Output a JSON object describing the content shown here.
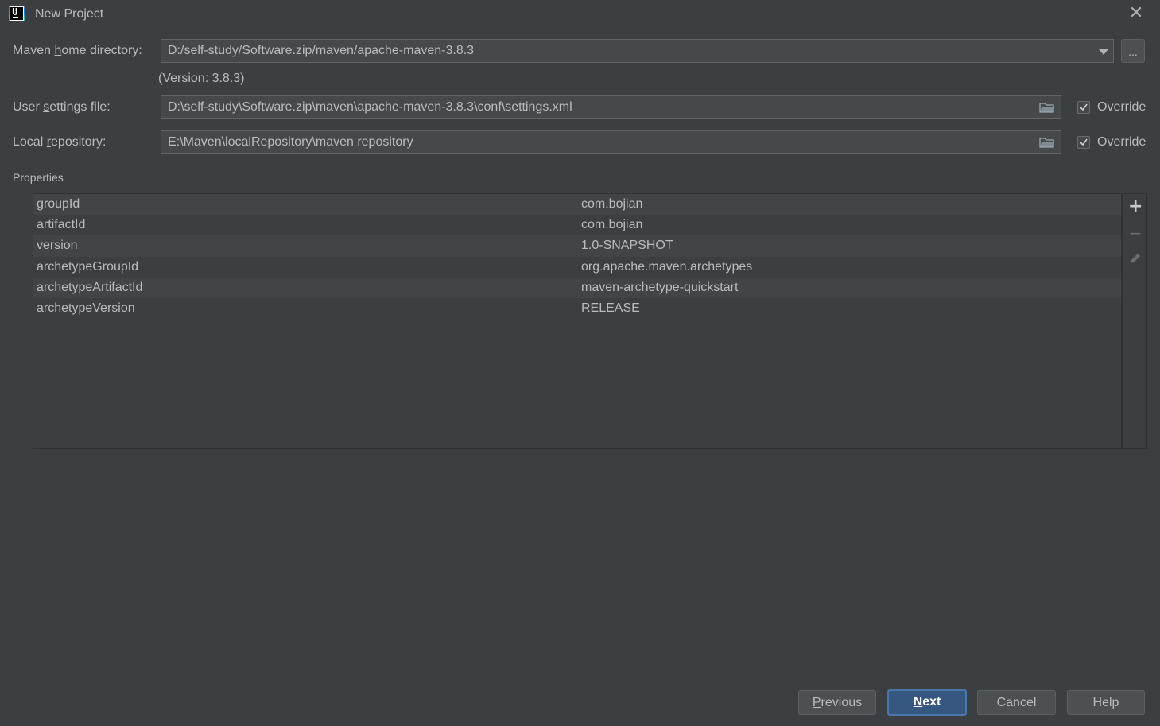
{
  "window": {
    "title": "New Project",
    "icon": "intellij-idea-icon",
    "close_icon": "close-icon"
  },
  "form": {
    "maven_home": {
      "label_pre": "Maven ",
      "label_mnemonic": "h",
      "label_post": "ome directory:",
      "value": "D:/self-study/Software.zip/maven/apache-maven-3.8.3",
      "browse_label": "...",
      "version_note": "(Version: 3.8.3)"
    },
    "user_settings": {
      "label_pre": "User ",
      "label_mnemonic": "s",
      "label_post": "ettings file:",
      "value": "D:\\self-study\\Software.zip\\maven\\apache-maven-3.8.3\\conf\\settings.xml",
      "override_label": "Override",
      "override_checked": true
    },
    "local_repository": {
      "label_pre": "Local ",
      "label_mnemonic": "r",
      "label_post": "epository:",
      "value": "E:\\Maven\\localRepository\\maven repository",
      "override_label": "Override",
      "override_checked": true
    }
  },
  "properties": {
    "title": "Properties",
    "rows": [
      {
        "key": "groupId",
        "value": "com.bojian"
      },
      {
        "key": "artifactId",
        "value": "com.bojian"
      },
      {
        "key": "version",
        "value": "1.0-SNAPSHOT"
      },
      {
        "key": "archetypeGroupId",
        "value": "org.apache.maven.archetypes"
      },
      {
        "key": "archetypeArtifactId",
        "value": "maven-archetype-quickstart"
      },
      {
        "key": "archetypeVersion",
        "value": "RELEASE"
      }
    ],
    "toolbar": {
      "add_icon": "plus-icon",
      "remove_icon": "minus-icon",
      "edit_icon": "pencil-icon"
    }
  },
  "footer": {
    "previous": {
      "mnemonic": "P",
      "rest": "revious"
    },
    "next": {
      "mnemonic": "N",
      "rest": "ext"
    },
    "cancel": "Cancel",
    "help": "Help"
  },
  "colors": {
    "background": "#3c3f41",
    "field": "#45494a",
    "primary_button": "#365880",
    "text": "#bbbbbb"
  }
}
